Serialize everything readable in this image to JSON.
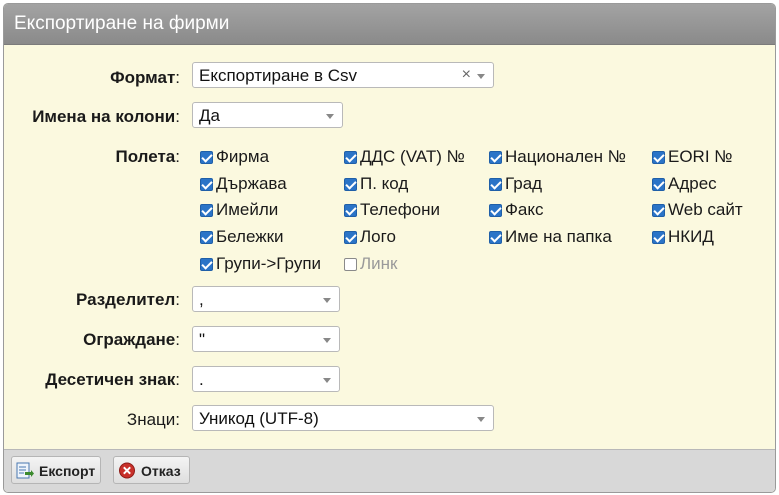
{
  "dialog": {
    "title": "Експортиране на фирми"
  },
  "form": {
    "format": {
      "label": "Формат",
      "colon": ":",
      "value": "Експортиране в Csv",
      "clear": "×"
    },
    "column_names": {
      "label": "Имена на колони",
      "colon": ":",
      "value": "Да"
    },
    "fields": {
      "label": "Полета",
      "colon": ":",
      "items": [
        {
          "label": "Фирма",
          "checked": true
        },
        {
          "label": "ДДС (VAT) №",
          "checked": true
        },
        {
          "label": "Национален №",
          "checked": true
        },
        {
          "label": "EORI №",
          "checked": true
        },
        {
          "label": "Държава",
          "checked": true
        },
        {
          "label": "П. код",
          "checked": true
        },
        {
          "label": "Град",
          "checked": true
        },
        {
          "label": "Адрес",
          "checked": true
        },
        {
          "label": "Имейли",
          "checked": true
        },
        {
          "label": "Телефони",
          "checked": true
        },
        {
          "label": "Факс",
          "checked": true
        },
        {
          "label": "Web сайт",
          "checked": true
        },
        {
          "label": "Бележки",
          "checked": true
        },
        {
          "label": "Лого",
          "checked": true
        },
        {
          "label": "Име на папка",
          "checked": true
        },
        {
          "label": "НКИД",
          "checked": true
        },
        {
          "label": "Групи->Групи",
          "checked": true
        },
        {
          "label": "Линк",
          "checked": false
        }
      ]
    },
    "separator": {
      "label": "Разделител",
      "colon": ":",
      "value": ","
    },
    "enclosure": {
      "label": "Ограждане",
      "colon": ":",
      "value": "\""
    },
    "decimal": {
      "label": "Десетичен знак",
      "colon": ":",
      "value": "."
    },
    "charset": {
      "label": "Знаци",
      "colon": ":",
      "value": "Уникод (UTF-8)"
    }
  },
  "footer": {
    "export_label": "Експорт",
    "cancel_label": "Отказ"
  },
  "colors": {
    "accent": "#2b74c7",
    "background": "#fbf9df",
    "titlebar": "#999999"
  }
}
